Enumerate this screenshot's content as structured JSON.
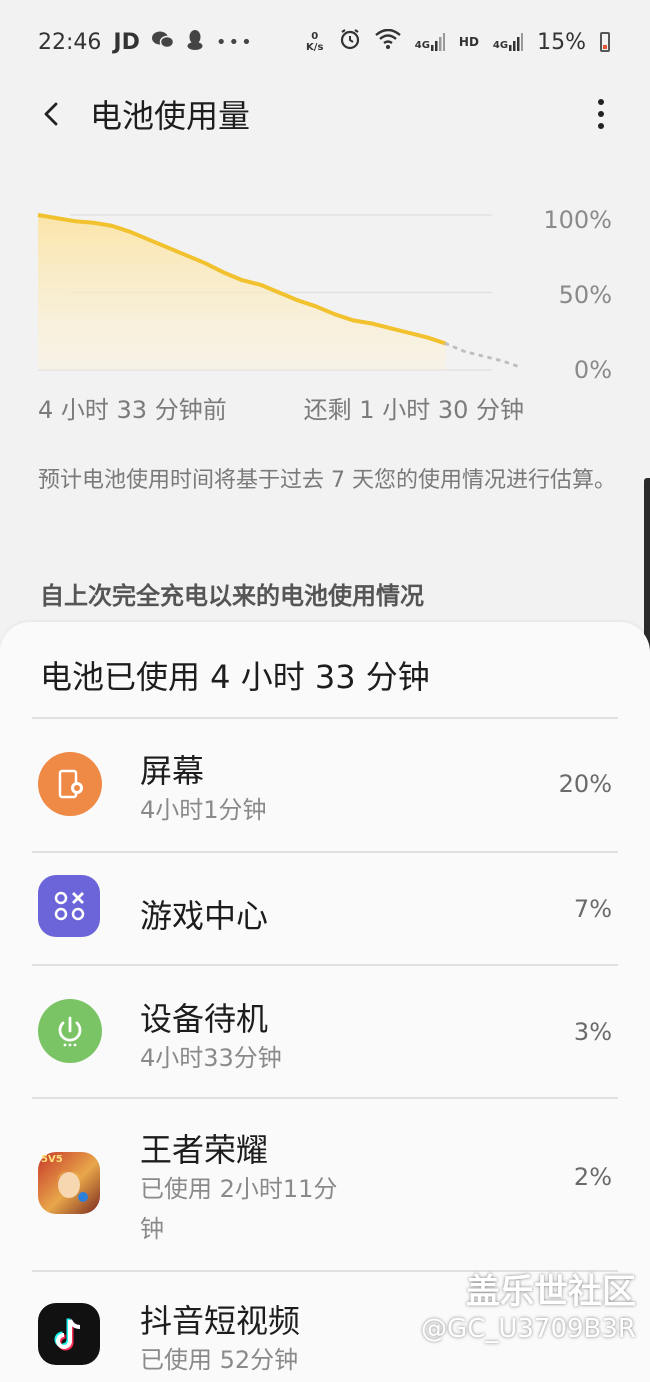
{
  "status_bar": {
    "time": "22:46",
    "left_icons": [
      "JD",
      "wechat-icon",
      "qq-icon",
      "more-dots-icon"
    ],
    "net_speed": "0 K/s",
    "signal_text_1": "4G",
    "hd_text": "HD",
    "signal_text_2": "4G",
    "battery_percent": "15%"
  },
  "header": {
    "title": "电池使用量"
  },
  "chart": {
    "y_labels": [
      "100%",
      "50%",
      "0%"
    ],
    "start_label": "4 小时 33 分钟前",
    "end_label": "还剩 1 小时 30 分钟"
  },
  "chart_data": {
    "type": "area",
    "title": "",
    "xlabel": "",
    "ylabel": "",
    "ylim": [
      0,
      100
    ],
    "y_ticks": [
      "100%",
      "50%",
      "0%"
    ],
    "x_labels": [
      "4 小时 33 分钟前",
      "还剩 1 小时 30 分钟"
    ],
    "series": [
      {
        "values": [
          100,
          98,
          96,
          95,
          93,
          89,
          84,
          79,
          74,
          69,
          63,
          58,
          55,
          50,
          45,
          41,
          36,
          32,
          30,
          27,
          24,
          21,
          17
        ],
        "color": "#f2c12e"
      },
      {
        "values": [
          17,
          12,
          9,
          6,
          2
        ],
        "style": "dotted",
        "color": "#bfbfbf"
      }
    ],
    "grid": true,
    "axis_position": "right"
  },
  "note": "预计电池使用时间将基于过去 7 天您的使用情况进行估算。",
  "section_heading": "自上次完全充电以来的电池使用情况",
  "card": {
    "title": "电池已使用 4 小时 33 分钟",
    "items": [
      {
        "name": "屏幕",
        "sub": "4小时1分钟",
        "percent": "20%",
        "icon": "screen-icon",
        "color": "#ee8a46"
      },
      {
        "name": "游戏中心",
        "sub": "",
        "percent": "7%",
        "icon": "game-center-icon",
        "color": "#6c65d9"
      },
      {
        "name": "设备待机",
        "sub": "4小时33分钟",
        "percent": "3%",
        "icon": "power-icon",
        "color": "#7bc465"
      },
      {
        "name": "王者荣耀",
        "sub": "已使用 2小时11分钟",
        "percent": "2%",
        "icon": "honor-of-kings-icon",
        "color": "#c7382a"
      },
      {
        "name": "抖音短视频",
        "sub": "已使用 52分钟",
        "percent": "",
        "icon": "douyin-icon",
        "color": "#111111"
      }
    ]
  },
  "watermark": {
    "line1": "盖乐世社区",
    "line2": "@GC_U3709B3R"
  }
}
